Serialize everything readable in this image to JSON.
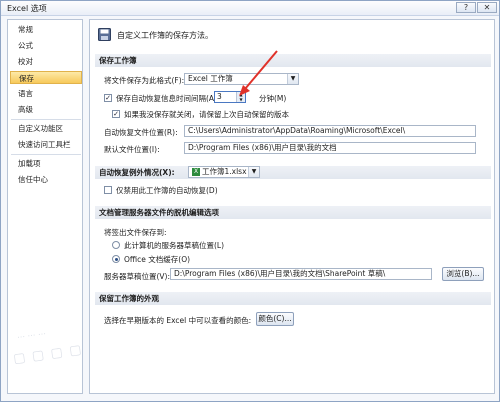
{
  "window": {
    "title": "Excel 选项",
    "help_label": "?",
    "close_label": "✕"
  },
  "sidebar": {
    "items": [
      {
        "label": "常规"
      },
      {
        "label": "公式"
      },
      {
        "label": "校对"
      },
      {
        "label": "保存",
        "active": true
      },
      {
        "label": "语言"
      },
      {
        "label": "高级"
      },
      {
        "label": "自定义功能区"
      },
      {
        "label": "快速访问工具栏"
      },
      {
        "label": "加载项"
      },
      {
        "label": "信任中心"
      }
    ]
  },
  "header": {
    "text": "自定义工作簿的保存方法。"
  },
  "save_workbooks": {
    "section_title": "保存工作簿",
    "format_label": "将文件保存为此格式(F):",
    "format_value": "Excel 工作簿",
    "autorecover_label": "保存自动恢复信息时间间隔(A)",
    "autorecover_minutes": "3",
    "minutes_label": "分钟(M)",
    "keep_last_label": "如果我没保存就关闭，请保留上次自动保留的版本",
    "autorecover_location_label": "自动恢复文件位置(R):",
    "autorecover_location_value": "C:\\Users\\Administrator\\AppData\\Roaming\\Microsoft\\Excel\\",
    "default_location_label": "默认文件位置(I):",
    "default_location_value": "D:\\Program Files (x86)\\用户目录\\我的文档"
  },
  "autorecover_exceptions": {
    "label": "自动恢复例外情况(X):",
    "workbook_value": "工作簿1.xlsx",
    "disable_label": "仅禁用此工作簿的自动恢复(D)"
  },
  "offline_editing": {
    "section_title": "文档管理服务器文件的脱机编辑选项",
    "save_to_label": "将签出文件保存到:",
    "option_server_label": "此计算机的服务器草稿位置(L)",
    "option_office_label": "Office 文档缓存(O)",
    "drafts_location_label": "服务器草稿位置(V):",
    "drafts_location_value": "D:\\Program Files (x86)\\用户目录\\我的文档\\SharePoint 草稿\\",
    "browse_label": "浏览(B)..."
  },
  "preserve_visual": {
    "section_title": "保留工作簿的外观",
    "colors_label": "选择在早期版本的 Excel 中可以查看的颜色:",
    "colors_button": "颜色(C)..."
  },
  "colors": {
    "accent": "#f7c95a",
    "arrow": "#e0322a"
  }
}
